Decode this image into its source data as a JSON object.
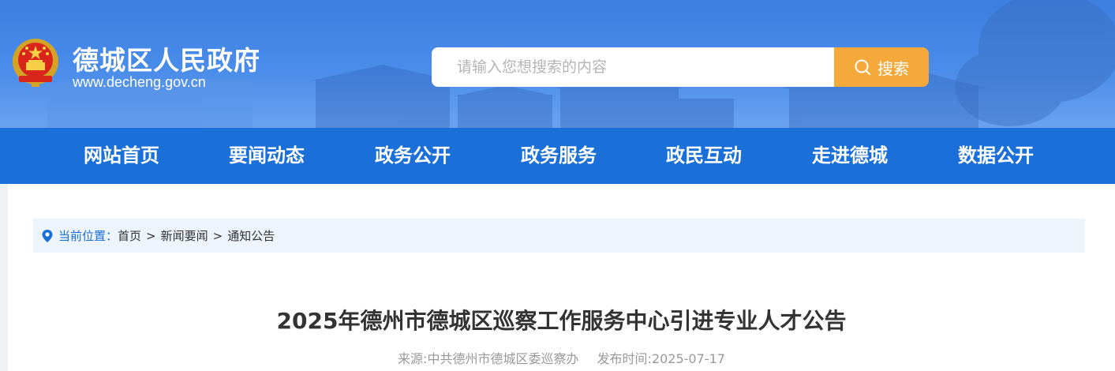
{
  "header": {
    "title": "德城区人民政府",
    "url": "www.decheng.gov.cn",
    "emblem_icon": "national-emblem-icon"
  },
  "search": {
    "placeholder": "请输入您想搜索的内容",
    "button_label": "搜索",
    "button_color": "#f6a93b"
  },
  "nav": {
    "items": [
      {
        "label": "网站首页"
      },
      {
        "label": "要闻动态"
      },
      {
        "label": "政务公开"
      },
      {
        "label": "政务服务"
      },
      {
        "label": "政民互动"
      },
      {
        "label": "走进德城"
      },
      {
        "label": "数据公开"
      }
    ],
    "background": "#1a6fd8"
  },
  "breadcrumb": {
    "label": "当前位置：",
    "items": [
      "首页",
      "新闻要闻",
      "通知公告"
    ],
    "separator": ">"
  },
  "article": {
    "title": "2025年德州市德城区巡察工作服务中心引进专业人才公告",
    "source": "来源:中共德州市德城区委巡察办",
    "published": "发布时间:2025-07-17"
  }
}
